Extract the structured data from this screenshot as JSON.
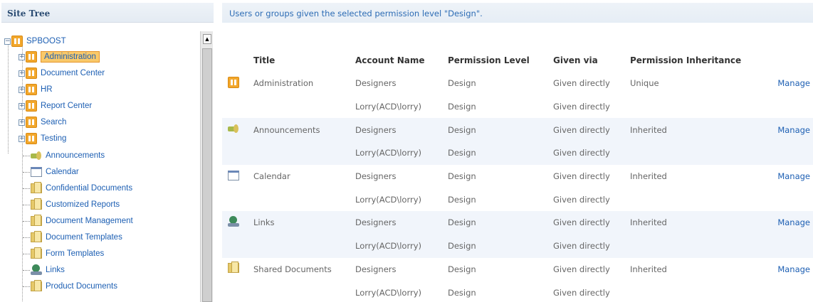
{
  "tree": {
    "header": "Site Tree",
    "root": "SPBOOST",
    "expandable": [
      {
        "label": "Administration",
        "selected": true
      },
      {
        "label": "Document Center"
      },
      {
        "label": "HR"
      },
      {
        "label": "Report Center"
      },
      {
        "label": "Search"
      },
      {
        "label": "Testing"
      }
    ],
    "lists": [
      {
        "label": "Announcements",
        "icon": "announcement-icon"
      },
      {
        "label": "Calendar",
        "icon": "calendar-icon"
      },
      {
        "label": "Confidential Documents",
        "icon": "document-library-icon"
      },
      {
        "label": "Customized Reports",
        "icon": "document-library-icon"
      },
      {
        "label": "Document Management",
        "icon": "document-library-icon"
      },
      {
        "label": "Document Templates",
        "icon": "document-library-icon"
      },
      {
        "label": "Form Templates",
        "icon": "document-library-icon"
      },
      {
        "label": "Links",
        "icon": "links-icon"
      },
      {
        "label": "Product Documents",
        "icon": "document-library-icon"
      }
    ]
  },
  "main": {
    "header": "Users or groups given the selected permission level \"Design\".",
    "columns": [
      "Title",
      "Account Name",
      "Permission Level",
      "Given via",
      "Permission Inheritance"
    ],
    "manage_label": "Manage",
    "items": [
      {
        "title": "Administration",
        "icon": "site-icon",
        "inheritance": "Unique",
        "rows": [
          {
            "account": "Designers",
            "level": "Design",
            "via": "Given directly"
          },
          {
            "account": "Lorry(ACD\\lorry)",
            "level": "Design",
            "via": "Given directly"
          }
        ]
      },
      {
        "title": "Announcements",
        "icon": "announcement-icon",
        "inheritance": "Inherited",
        "rows": [
          {
            "account": "Designers",
            "level": "Design",
            "via": "Given directly"
          },
          {
            "account": "Lorry(ACD\\lorry)",
            "level": "Design",
            "via": "Given directly"
          }
        ]
      },
      {
        "title": "Calendar",
        "icon": "calendar-icon",
        "inheritance": "Inherited",
        "rows": [
          {
            "account": "Designers",
            "level": "Design",
            "via": "Given directly"
          },
          {
            "account": "Lorry(ACD\\lorry)",
            "level": "Design",
            "via": "Given directly"
          }
        ]
      },
      {
        "title": "Links",
        "icon": "links-icon",
        "inheritance": "Inherited",
        "rows": [
          {
            "account": "Designers",
            "level": "Design",
            "via": "Given directly"
          },
          {
            "account": "Lorry(ACD\\lorry)",
            "level": "Design",
            "via": "Given directly"
          }
        ]
      },
      {
        "title": "Shared Documents",
        "icon": "document-library-icon",
        "inheritance": "Inherited",
        "rows": [
          {
            "account": "Designers",
            "level": "Design",
            "via": "Given directly"
          },
          {
            "account": "Lorry(ACD\\lorry)",
            "level": "Design",
            "via": "Given directly"
          }
        ]
      }
    ]
  }
}
